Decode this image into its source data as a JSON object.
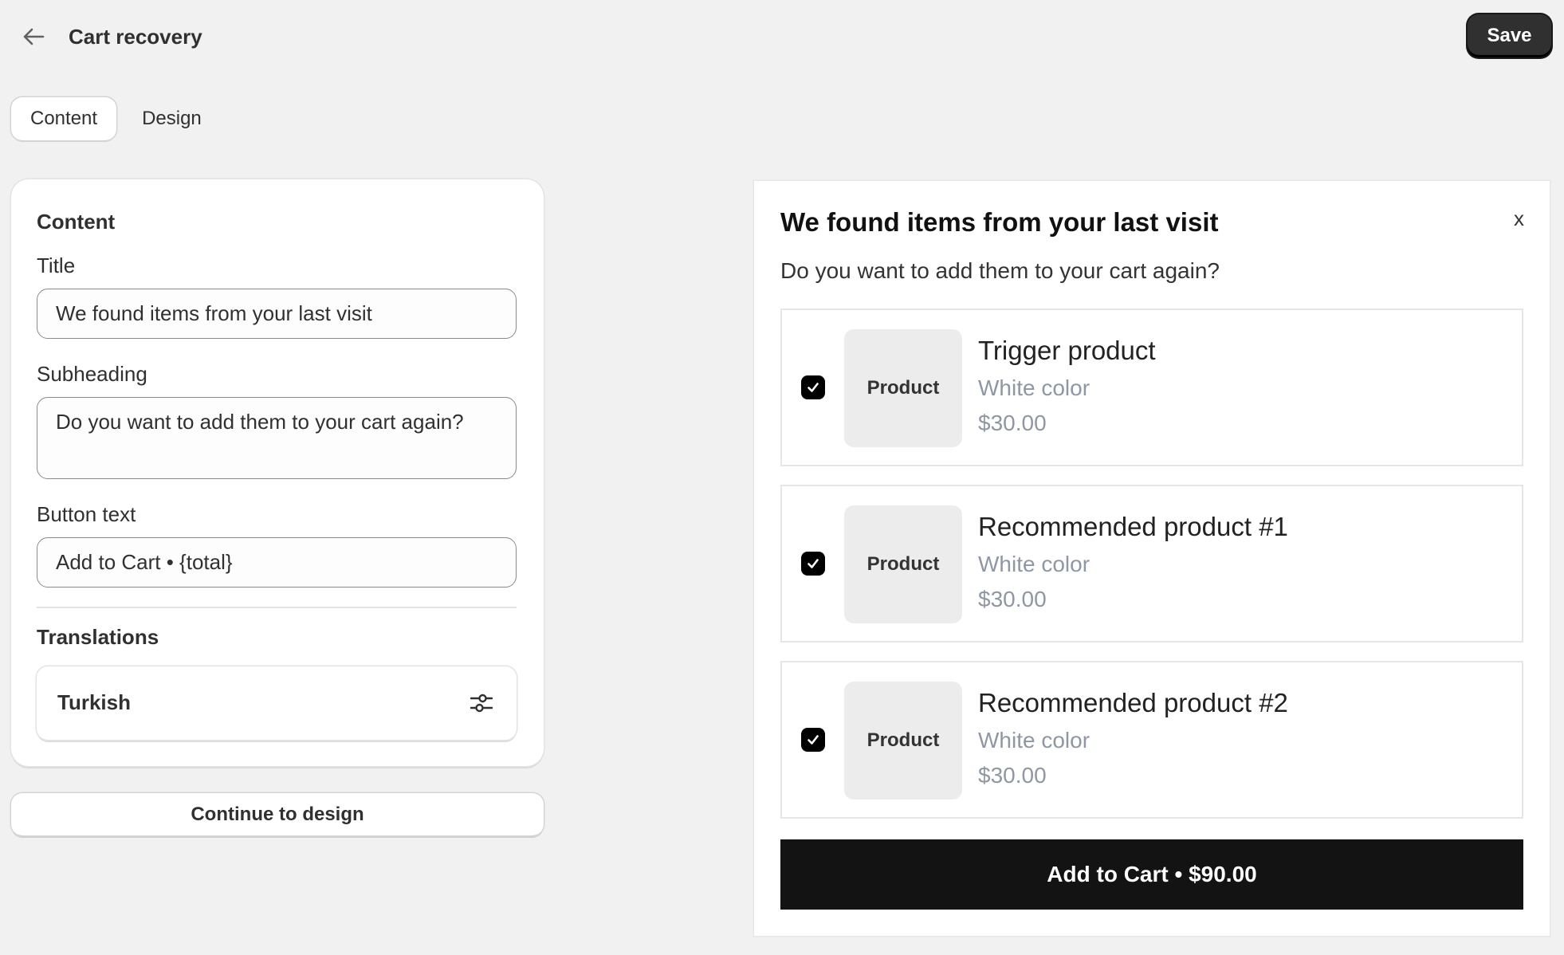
{
  "header": {
    "title": "Cart recovery",
    "save_label": "Save"
  },
  "tabs": [
    {
      "label": "Content",
      "active": true
    },
    {
      "label": "Design",
      "active": false
    }
  ],
  "content_card": {
    "heading": "Content",
    "title_label": "Title",
    "title_value": "We found items from your last visit",
    "subheading_label": "Subheading",
    "subheading_value": "Do you want to add them to your cart again?",
    "button_text_label": "Button text",
    "button_text_value": "Add to Cart • {total}",
    "translations_label": "Translations",
    "translation_language": "Turkish"
  },
  "continue_label": "Continue to design",
  "preview": {
    "title": "We found items from your last visit",
    "close_label": "x",
    "subtitle": "Do you want to add them to your cart again?",
    "products": [
      {
        "image_label": "Product",
        "name": "Trigger product",
        "variant": "White color",
        "price": "$30.00",
        "checked": true
      },
      {
        "image_label": "Product",
        "name": "Recommended product #1",
        "variant": "White color",
        "price": "$30.00",
        "checked": true
      },
      {
        "image_label": "Product",
        "name": "Recommended product #2",
        "variant": "White color",
        "price": "$30.00",
        "checked": true
      }
    ],
    "add_button": "Add to Cart • $90.00"
  },
  "colors": {
    "background": "#f1f1f1",
    "primary_button": "#303030",
    "cta": "#131313",
    "muted_text": "#8e97a3"
  }
}
